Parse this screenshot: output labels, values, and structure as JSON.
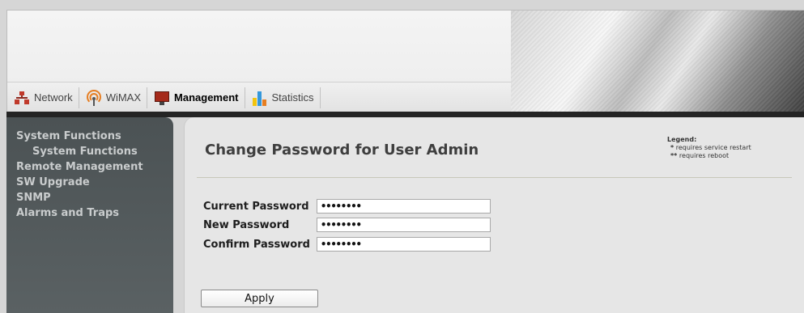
{
  "nav": {
    "tabs": [
      {
        "label": "Network",
        "icon": "network-icon"
      },
      {
        "label": "WiMAX",
        "icon": "wimax-icon"
      },
      {
        "label": "Management",
        "icon": "management-icon",
        "active": true
      },
      {
        "label": "Statistics",
        "icon": "statistics-icon"
      }
    ]
  },
  "sidebar": {
    "items": [
      {
        "label": "System Functions"
      },
      {
        "label": "System Functions",
        "sub": true
      },
      {
        "label": "Remote Management"
      },
      {
        "label": "SW Upgrade"
      },
      {
        "label": "SNMP"
      },
      {
        "label": "Alarms and Traps"
      }
    ]
  },
  "main": {
    "title": "Change Password for User Admin",
    "legend": {
      "title": "Legend:",
      "restart_mark": "*",
      "restart": "requires service restart",
      "reboot_mark": "**",
      "reboot": "requires reboot"
    },
    "fields": {
      "current": {
        "label": "Current Password",
        "value": "••••••••"
      },
      "new": {
        "label": "New Password",
        "value": "••••••••"
      },
      "confirm": {
        "label": "Confirm Password",
        "value": "••••••••"
      }
    },
    "apply_label": "Apply"
  },
  "colors": {
    "sidebar_bg": "#4f5658",
    "sidebar_text": "#c9cccd",
    "panel_bg": "#e6e6e6",
    "dark_bar": "#242424"
  }
}
